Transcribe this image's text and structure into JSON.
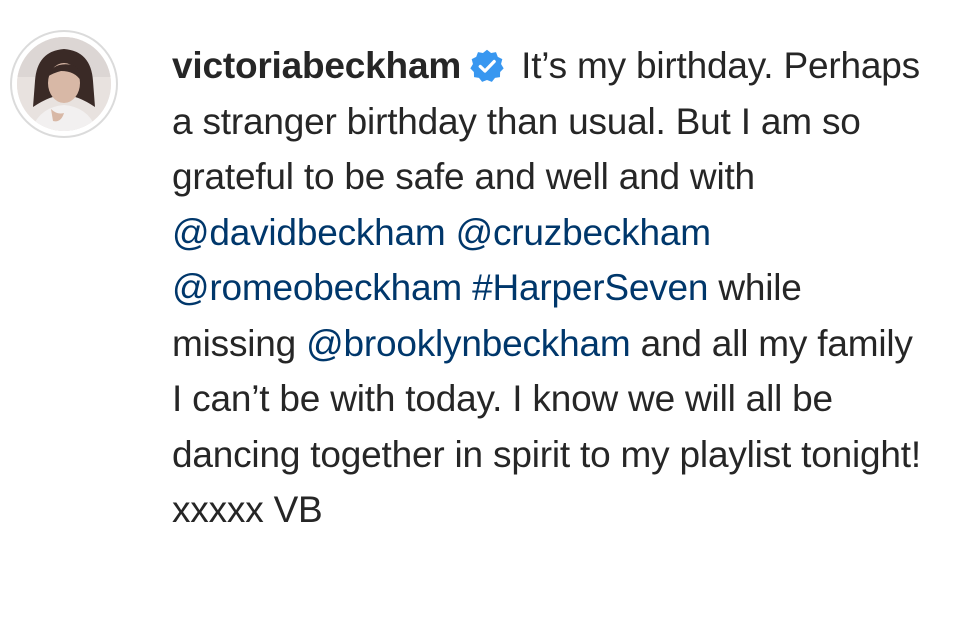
{
  "post": {
    "username": "victoriabeckham",
    "verified_icon": "verified-badge-icon",
    "caption": {
      "part1": "It’s my birthday. Perhaps a stranger birthday than usual. But I am so grateful to be safe and well and with",
      "mention1": "@davidbeckham",
      "mention2": "@cruzbeckham",
      "mention3": "@romeobeckham",
      "hashtag1": "#HarperSeven",
      "part2": "while missing",
      "mention4": "@brooklynbeckham",
      "part3": "and all my family I can’t be with today. I know we will all be dancing together in spirit to my playlist tonight! xxxxx VB"
    }
  },
  "colors": {
    "text": "#262626",
    "link": "#00376b",
    "verified": "#3897f0"
  }
}
